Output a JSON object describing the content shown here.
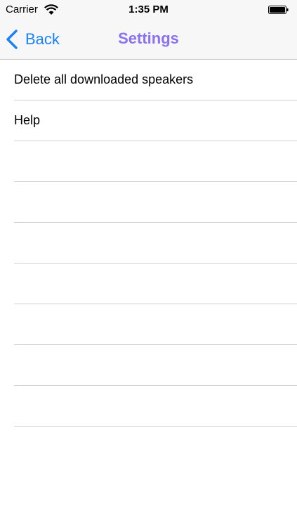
{
  "status_bar": {
    "carrier": "Carrier",
    "time": "1:35 PM",
    "wifi_icon": "wifi-icon",
    "battery_icon": "battery-icon"
  },
  "nav": {
    "back_label": "Back",
    "title": "Settings",
    "back_icon": "chevron-left-icon",
    "accent_color": "#1a82f6",
    "title_color": "#8b72f0"
  },
  "list": {
    "items": [
      "Delete all downloaded speakers",
      "Help",
      "",
      "",
      "",
      "",
      "",
      "",
      ""
    ]
  }
}
